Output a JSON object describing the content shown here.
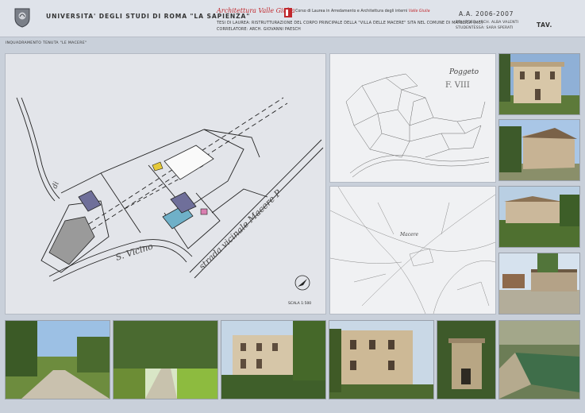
{
  "header": {
    "university": "UNIVERSITA' DEGLI STUDI DI ROMA \"LA SAPIENZA\"",
    "logo_text": "Architettura Valle Giulia",
    "course_prefix": "Corso di Laurea in Arredamento e Architettura",
    "course_suffix": "degli interni",
    "course_red": "Valle Giulia",
    "thesis_line": "TESI DI LAUREA: RISTRUTTURAZIONE DEL CORPO PRINCIPALE DELLA \"VILLA DELLE MACERE\" SITA NEL COMUNE DI MATELICA (MC)",
    "correlatore": "CORRELATORE: ARCH. GIOVANNI PAESCH",
    "academic_year": "A.A. 2006-2007",
    "relatore": "RELATORE: ARCH. ALBA VALENTI",
    "student": "STUDENTESSA: SARA SPERATI",
    "tav": "TAV."
  },
  "subtitle": "INQUADRAMENTO TENUTA \"LE MACERE\"",
  "main_map": {
    "road_label_1": "S. Vicino",
    "road_label_2": "strada vicinale Macere P",
    "corner_label": "di",
    "scale": "SCALA 1:500"
  },
  "cadastral_map": {
    "label_top": "Poggeto",
    "sheet": "F. VIII"
  },
  "historic_map": {
    "label": "Macere"
  },
  "colors": {
    "header_bg": "#dfe3ea",
    "page_bg": "#c9d0da",
    "accent_red": "#c0282d",
    "building_blue": "#6f6f9a",
    "building_grey": "#9a9a9a",
    "building_cyan": "#6fb0c8",
    "building_yellow": "#e5c93a",
    "building_pink": "#d97fb0"
  },
  "icons": {
    "crest": "university-crest-icon",
    "north": "north-arrow-icon"
  }
}
